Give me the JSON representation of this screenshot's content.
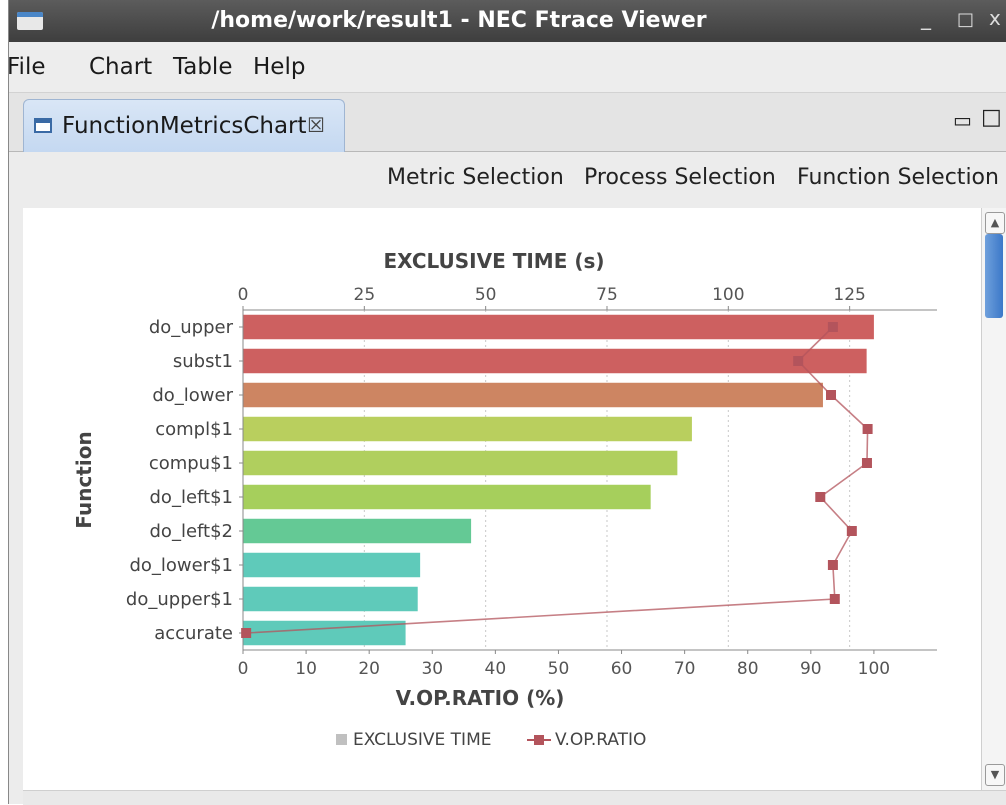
{
  "window": {
    "title": "/home/work/result1 - NEC Ftrace Viewer",
    "minimize_glyph": "_",
    "maximize_glyph": "□",
    "close_glyph": "x"
  },
  "menu": {
    "items": [
      "File",
      "Chart",
      "Table",
      "Help"
    ]
  },
  "tab": {
    "label": "FunctionMetricsChart",
    "close_glyph": "☒",
    "minimize_glyph": "▭",
    "maximize_glyph": "□"
  },
  "toolbar": {
    "metric_selection": "Metric Selection",
    "process_selection": "Process Selection",
    "function_selection": "Function Selection"
  },
  "icons": {
    "app": "app-window-icon",
    "tab": "chart-view-icon"
  },
  "chart_data": {
    "type": "bar",
    "orientation": "horizontal",
    "ylabel": "Function",
    "top_axis_label": "EXCLUSIVE TIME (s)",
    "bottom_axis_label": "V.OP.RATIO (%)",
    "categories": [
      "do_upper",
      "subst1",
      "do_lower",
      "compl$1",
      "compu$1",
      "do_left$1",
      "do_left$2",
      "do_lower$1",
      "do_upper$1",
      "accurate"
    ],
    "top_axis": {
      "range": [
        0,
        143
      ],
      "ticks": [
        0,
        25,
        50,
        75,
        100,
        125
      ]
    },
    "bottom_axis": {
      "range": [
        0,
        110
      ],
      "ticks": [
        0,
        10,
        20,
        30,
        40,
        50,
        60,
        70,
        80,
        90,
        100
      ]
    },
    "series": [
      {
        "name": "EXCLUSIVE TIME",
        "kind": "bar",
        "axis": "top",
        "values": [
          130,
          128.5,
          119.5,
          92.5,
          89.5,
          84,
          47,
          36.5,
          36,
          33.5
        ],
        "colors": [
          "#cd6060",
          "#cd6060",
          "#cd8562",
          "#b9cf5e",
          "#b0cf5e",
          "#a6cf5c",
          "#64c995",
          "#5fcaba",
          "#5fcaba",
          "#5fcaba"
        ]
      },
      {
        "name": "V.OP.RATIO",
        "kind": "line",
        "axis": "bottom",
        "color": "#b3545c",
        "values": [
          93.5,
          88,
          93.2,
          99,
          98.9,
          91.5,
          96.5,
          93.5,
          93.8,
          0.5
        ]
      }
    ],
    "legend": {
      "position": "bottom",
      "items": [
        "EXCLUSIVE TIME",
        "V.OP.RATIO"
      ],
      "bar_legend_color": "#c0c0c0"
    },
    "grid": {
      "vertical": true,
      "style": "dotted"
    }
  }
}
